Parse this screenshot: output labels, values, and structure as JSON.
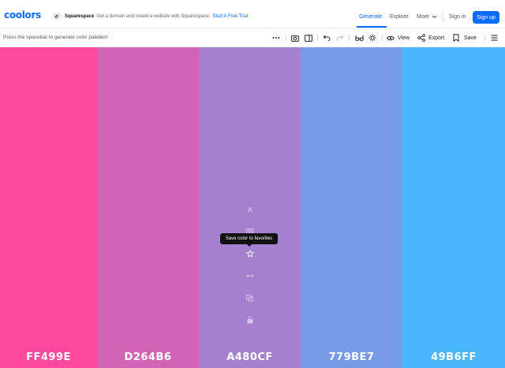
{
  "brand": {
    "logo": "coolors"
  },
  "promo": {
    "name": "Squarespace",
    "text": "Get a domain and create a website with Squarespace.",
    "link": "Start A Free Trial"
  },
  "nav": {
    "generate": "Generate",
    "explore": "Explore",
    "more": "More",
    "signin": "Sign in",
    "signup": "Sign up"
  },
  "toolbar": {
    "hint": "Press the spacebar to generate color palettes!",
    "view": "View",
    "export": "Export",
    "save": "Save"
  },
  "palette": {
    "colors": [
      {
        "hex": "FF499E",
        "color": "#FF499E"
      },
      {
        "hex": "D264B6",
        "color": "#D264B6"
      },
      {
        "hex": "A480CF",
        "color": "#A480CF"
      },
      {
        "hex": "779BE7",
        "color": "#779BE7"
      },
      {
        "hex": "49B6FF",
        "color": "#49B6FF"
      }
    ],
    "tooltip": "Save color to favorites"
  },
  "colors": {
    "accent": "#0a6cff"
  },
  "icons": [
    "squarespace-icon",
    "chevron-down-icon",
    "more-icon",
    "camera-icon",
    "sidebar-icon",
    "undo-icon",
    "redo-icon",
    "glasses-icon",
    "sun-icon",
    "eye-icon",
    "share-icon",
    "bookmark-icon",
    "menu-icon",
    "close-icon",
    "grid-icon",
    "star-icon",
    "arrows-icon",
    "copy-icon",
    "lock-icon"
  ]
}
